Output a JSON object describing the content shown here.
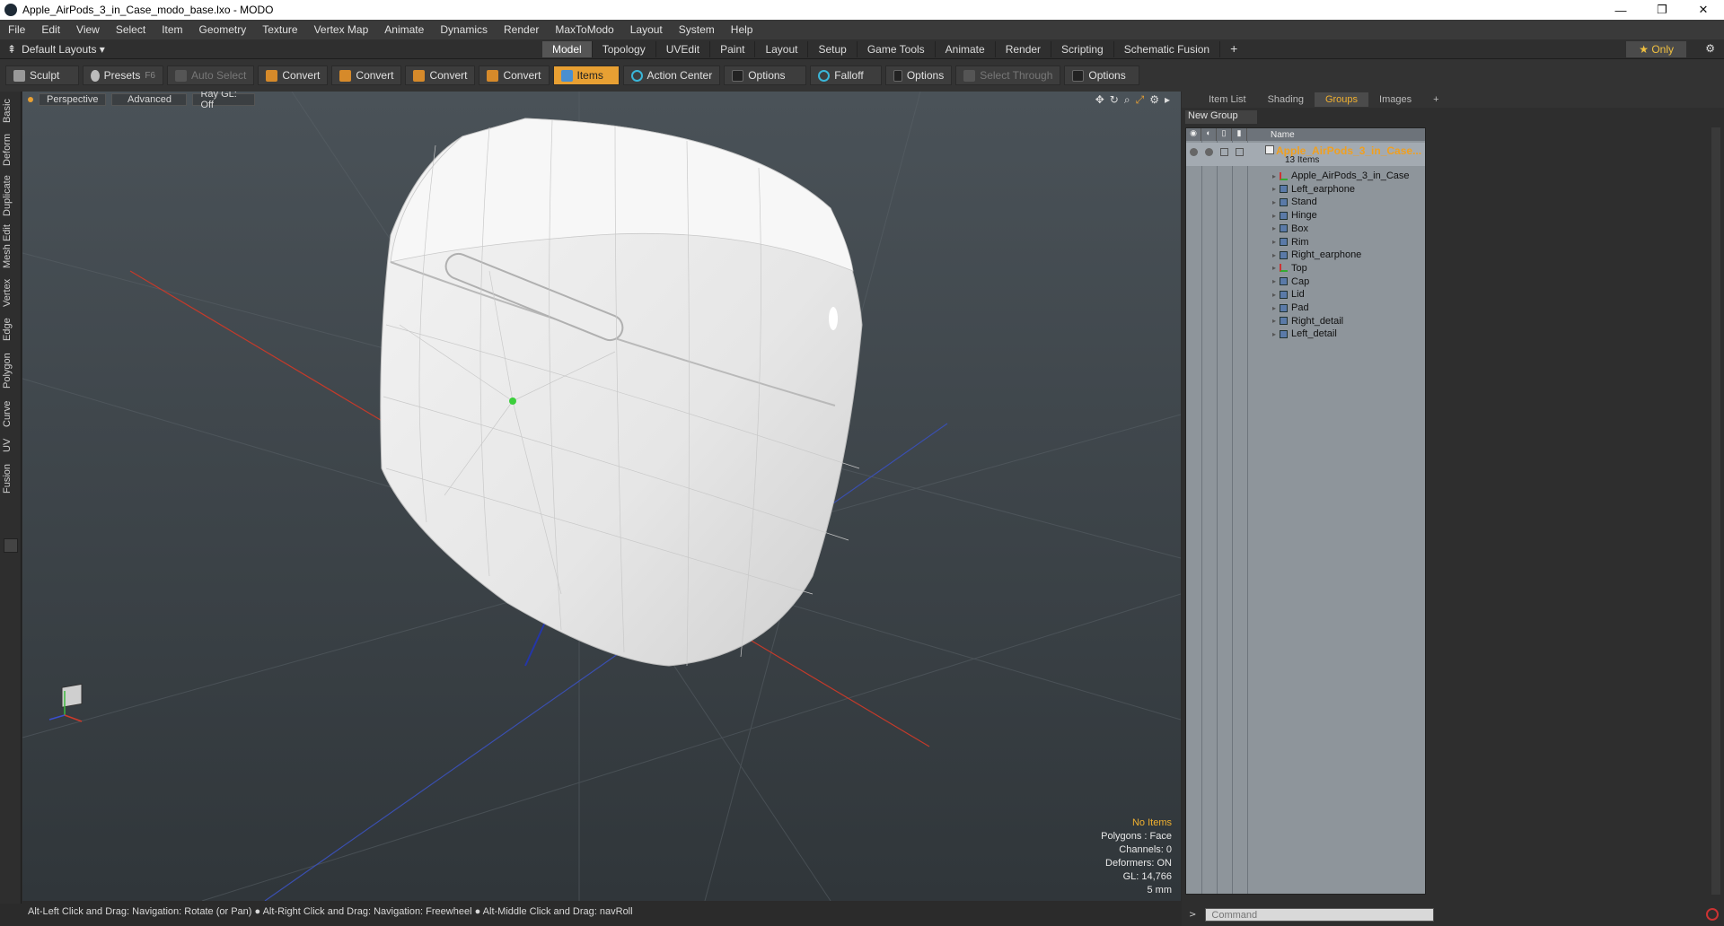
{
  "window": {
    "title": "Apple_AirPods_3_in_Case_modo_base.lxo - MODO",
    "controls": [
      "—",
      "❐",
      "✕"
    ]
  },
  "menu": [
    "File",
    "Edit",
    "View",
    "Select",
    "Item",
    "Geometry",
    "Texture",
    "Vertex Map",
    "Animate",
    "Dynamics",
    "Render",
    "MaxToModo",
    "Layout",
    "System",
    "Help"
  ],
  "layoutbar": {
    "default_layouts": "Default Layouts ▾",
    "tabs": [
      "Model",
      "Topology",
      "UVEdit",
      "Paint",
      "Layout",
      "Setup",
      "Game Tools",
      "Animate",
      "Render",
      "Scripting",
      "Schematic Fusion"
    ],
    "active_tab": "Model",
    "add": "+",
    "only": "★  Only"
  },
  "toolbar": {
    "sculpt": "Sculpt",
    "presets": "Presets",
    "presets_key": "F6",
    "auto_select": "Auto Select",
    "convert1": "Convert",
    "convert2": "Convert",
    "convert3": "Convert",
    "convert4": "Convert",
    "items": "Items",
    "action_center": "Action Center",
    "options1": "Options",
    "falloff": "Falloff",
    "options2": "Options",
    "select_through": "Select Through",
    "options3": "Options"
  },
  "left_tabs": [
    "Basic",
    "Deform",
    "Duplicate",
    "Mesh Edit",
    "Vertex",
    "Edge",
    "Polygon",
    "Curve",
    "UV",
    "Fusion"
  ],
  "viewport": {
    "perspective": "Perspective",
    "advanced": "Advanced",
    "raygl": "Ray GL: Off",
    "stats": {
      "no_items": "No Items",
      "polygons": "Polygons : Face",
      "channels": "Channels: 0",
      "deformers": "Deformers: ON",
      "gl": "GL: 14,766",
      "scale": "5 mm"
    }
  },
  "status": "Alt-Left Click and Drag: Navigation: Rotate (or Pan) ● Alt-Right Click and Drag: Navigation: Freewheel ● Alt-Middle Click and Drag: navRoll",
  "right_panel": {
    "tabs": [
      "Item List",
      "Shading",
      "Groups",
      "Images",
      "+"
    ],
    "active_tab": "Groups",
    "new_group": "New Group",
    "name_header": "Name",
    "group_name": "Apple_AirPods_3_in_Case...",
    "group_count": "13 Items",
    "items": [
      {
        "name": "Apple_AirPods_3_in_Case",
        "type": "locator"
      },
      {
        "name": "Left_earphone",
        "type": "mesh"
      },
      {
        "name": "Stand",
        "type": "mesh"
      },
      {
        "name": "Hinge",
        "type": "mesh"
      },
      {
        "name": "Box",
        "type": "mesh"
      },
      {
        "name": "Rim",
        "type": "mesh"
      },
      {
        "name": "Right_earphone",
        "type": "mesh"
      },
      {
        "name": "Top",
        "type": "locator"
      },
      {
        "name": "Cap",
        "type": "mesh"
      },
      {
        "name": "Lid",
        "type": "mesh"
      },
      {
        "name": "Pad",
        "type": "mesh"
      },
      {
        "name": "Right_detail",
        "type": "mesh"
      },
      {
        "name": "Left_detail",
        "type": "mesh"
      }
    ],
    "command_placeholder": "Command"
  },
  "colors": {
    "accent": "#e8a033",
    "group_title": "#f0a020",
    "viewport_top": "#4a5258",
    "viewport_bottom": "#30363a"
  }
}
